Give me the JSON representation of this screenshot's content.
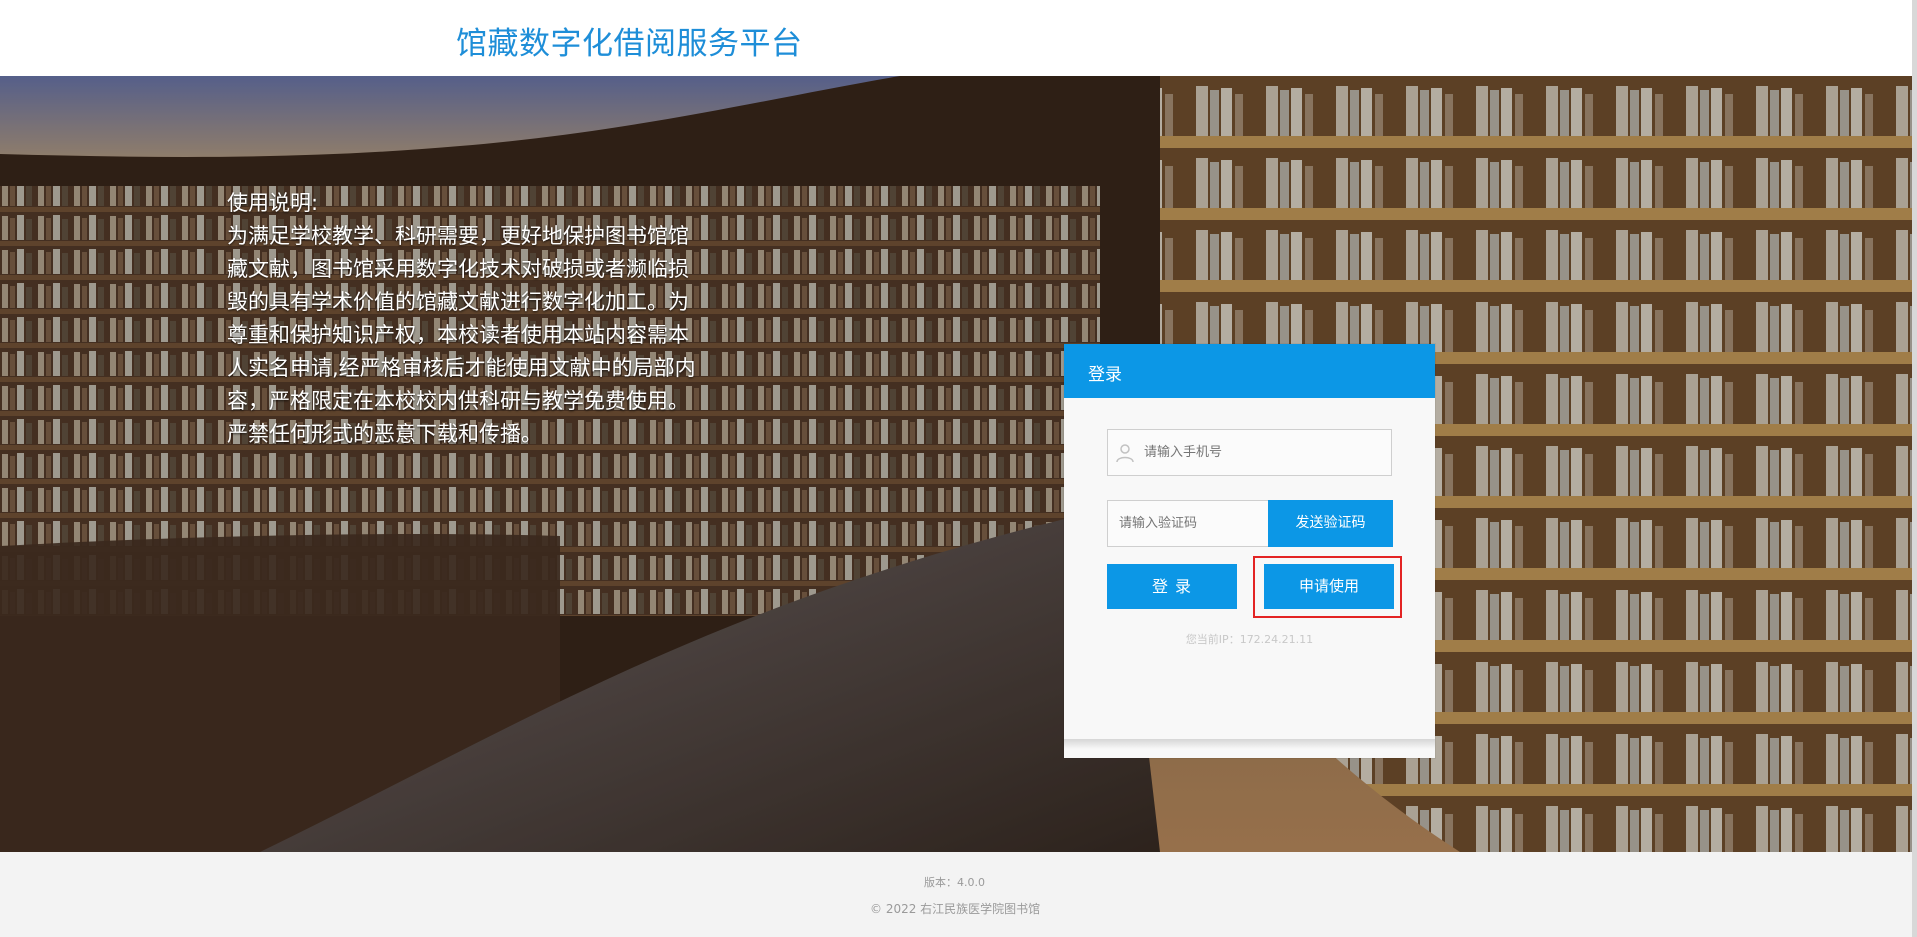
{
  "header": {
    "title": "馆藏数字化借阅服务平台"
  },
  "instructions": {
    "title": "使用说明:",
    "body": "为满足学校教学、科研需要，更好地保护图书馆馆藏文献，图书馆采用数字化技术对破损或者濒临损毁的具有学术价值的馆藏文献进行数字化加工。为尊重和保护知识产权，本校读者使用本站内容需本人实名申请,经严格审核后才能使用文献中的局部内容，严格限定在本校校内供科研与教学免费使用。严禁任何形式的恶意下载和传播。"
  },
  "login": {
    "title": "登录",
    "phone_placeholder": "请输入手机号",
    "code_placeholder": "请输入验证码",
    "send_code_label": "发送验证码",
    "login_label": "登 录",
    "apply_label": "申请使用",
    "ip_text": "您当前IP：172.24.21.11"
  },
  "footer": {
    "version": "版本：4.0.0",
    "copyright": "© 2022   右江民族医学院图书馆"
  },
  "colors": {
    "brand_blue": "#0c97e6",
    "title_blue": "#1e8ed8",
    "highlight_red": "#e32424"
  },
  "icons": {
    "user": "user-icon"
  }
}
